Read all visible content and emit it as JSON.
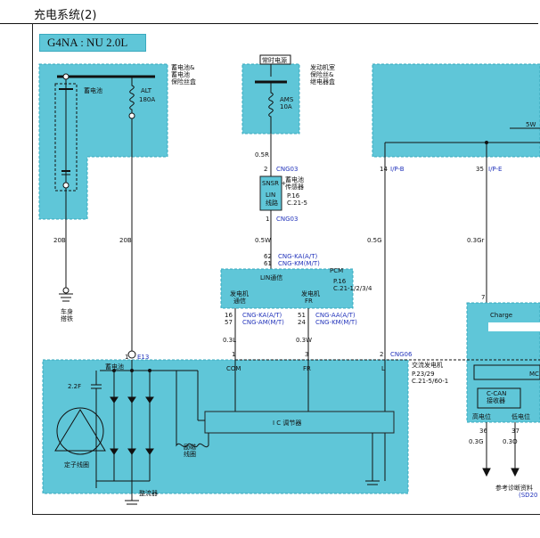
{
  "header": {
    "title": "充电系统(2)"
  },
  "badge": {
    "label": "G4NA : NU 2.0L"
  },
  "battery_box": {
    "title": [
      "蓄电池&",
      "蓄电池",
      "保险丝盒"
    ],
    "battery": "蓄电池",
    "fuse": [
      "ALT",
      "180A"
    ]
  },
  "hot_box": {
    "top": "常时电源",
    "title": [
      "发动机室",
      "保险丝&",
      "继电器盒"
    ],
    "fuse": [
      "AMS",
      "10A"
    ]
  },
  "wires": {
    "w1": "0.5R",
    "w2": "0.5W",
    "w3": "20B",
    "w4": "20B",
    "w5": "0.5G",
    "w6": "0.3Gr",
    "w7": "0.3L",
    "w8": "0.3W",
    "w9": "0.3G",
    "w10": "0.3O",
    "w11": "5W"
  },
  "sensor": {
    "pin_top": "2",
    "conn_top": "CNG03",
    "label_top": "SNSR +",
    "label_mid": "LIN",
    "label_bot": "线路",
    "name": [
      "蓄电池",
      "传感器"
    ],
    "ref": [
      "P.16",
      "C.21-5"
    ],
    "pin_bot": "1",
    "conn_bot": "CNG03"
  },
  "pcm": {
    "pins_in": [
      "62",
      "61"
    ],
    "conns_in": [
      "CNG-KA(A/T)",
      "CNG-KM(M/T)"
    ],
    "name": "PCM",
    "ref": [
      "P.16",
      "C.21-1/2/3/4"
    ],
    "bus": "LIN通信",
    "left_label": [
      "发电机",
      "通信"
    ],
    "right_label": [
      "发电机",
      "FR"
    ],
    "pins_l": [
      "16",
      "57"
    ],
    "conns_l": [
      "CNG-KA(A/T)",
      "CNG-AM(M/T)"
    ],
    "pins_r": [
      "51",
      "24"
    ],
    "conns_r": [
      "CNG-AA(A/T)",
      "CNG-KM(M/T)"
    ]
  },
  "ground": {
    "label": [
      "车身",
      "搭铁"
    ]
  },
  "alt": {
    "pin_b": "1",
    "conn_b": "E13",
    "pin_com": "1",
    "pin_fr": "3",
    "pin_l": "2",
    "conn": "CNG06",
    "name": "交流发电机",
    "ref": [
      "P.23/29",
      "C.21-5/60-1"
    ],
    "battery": "蓄电池",
    "com": "COM",
    "fr": "FR",
    "l": "L",
    "cap": "2.2F",
    "regulator": "I C 调节器",
    "field": [
      "励磁",
      "线圈"
    ],
    "stator": "定子线圈",
    "rectifier": "整流器"
  },
  "right": {
    "pin14": "14",
    "conn14": "I/P-B",
    "pin35": "35",
    "conn35": "I/P-E",
    "pin7": "7",
    "charge": "Charge",
    "mc": "MC",
    "ccan": [
      "C-CAN",
      "接收器"
    ],
    "hi": "高电位",
    "lo": "低电位",
    "pin36": "36",
    "pin37": "37",
    "ref_note": [
      "参考诊断资料",
      "(SD20"
    ]
  }
}
